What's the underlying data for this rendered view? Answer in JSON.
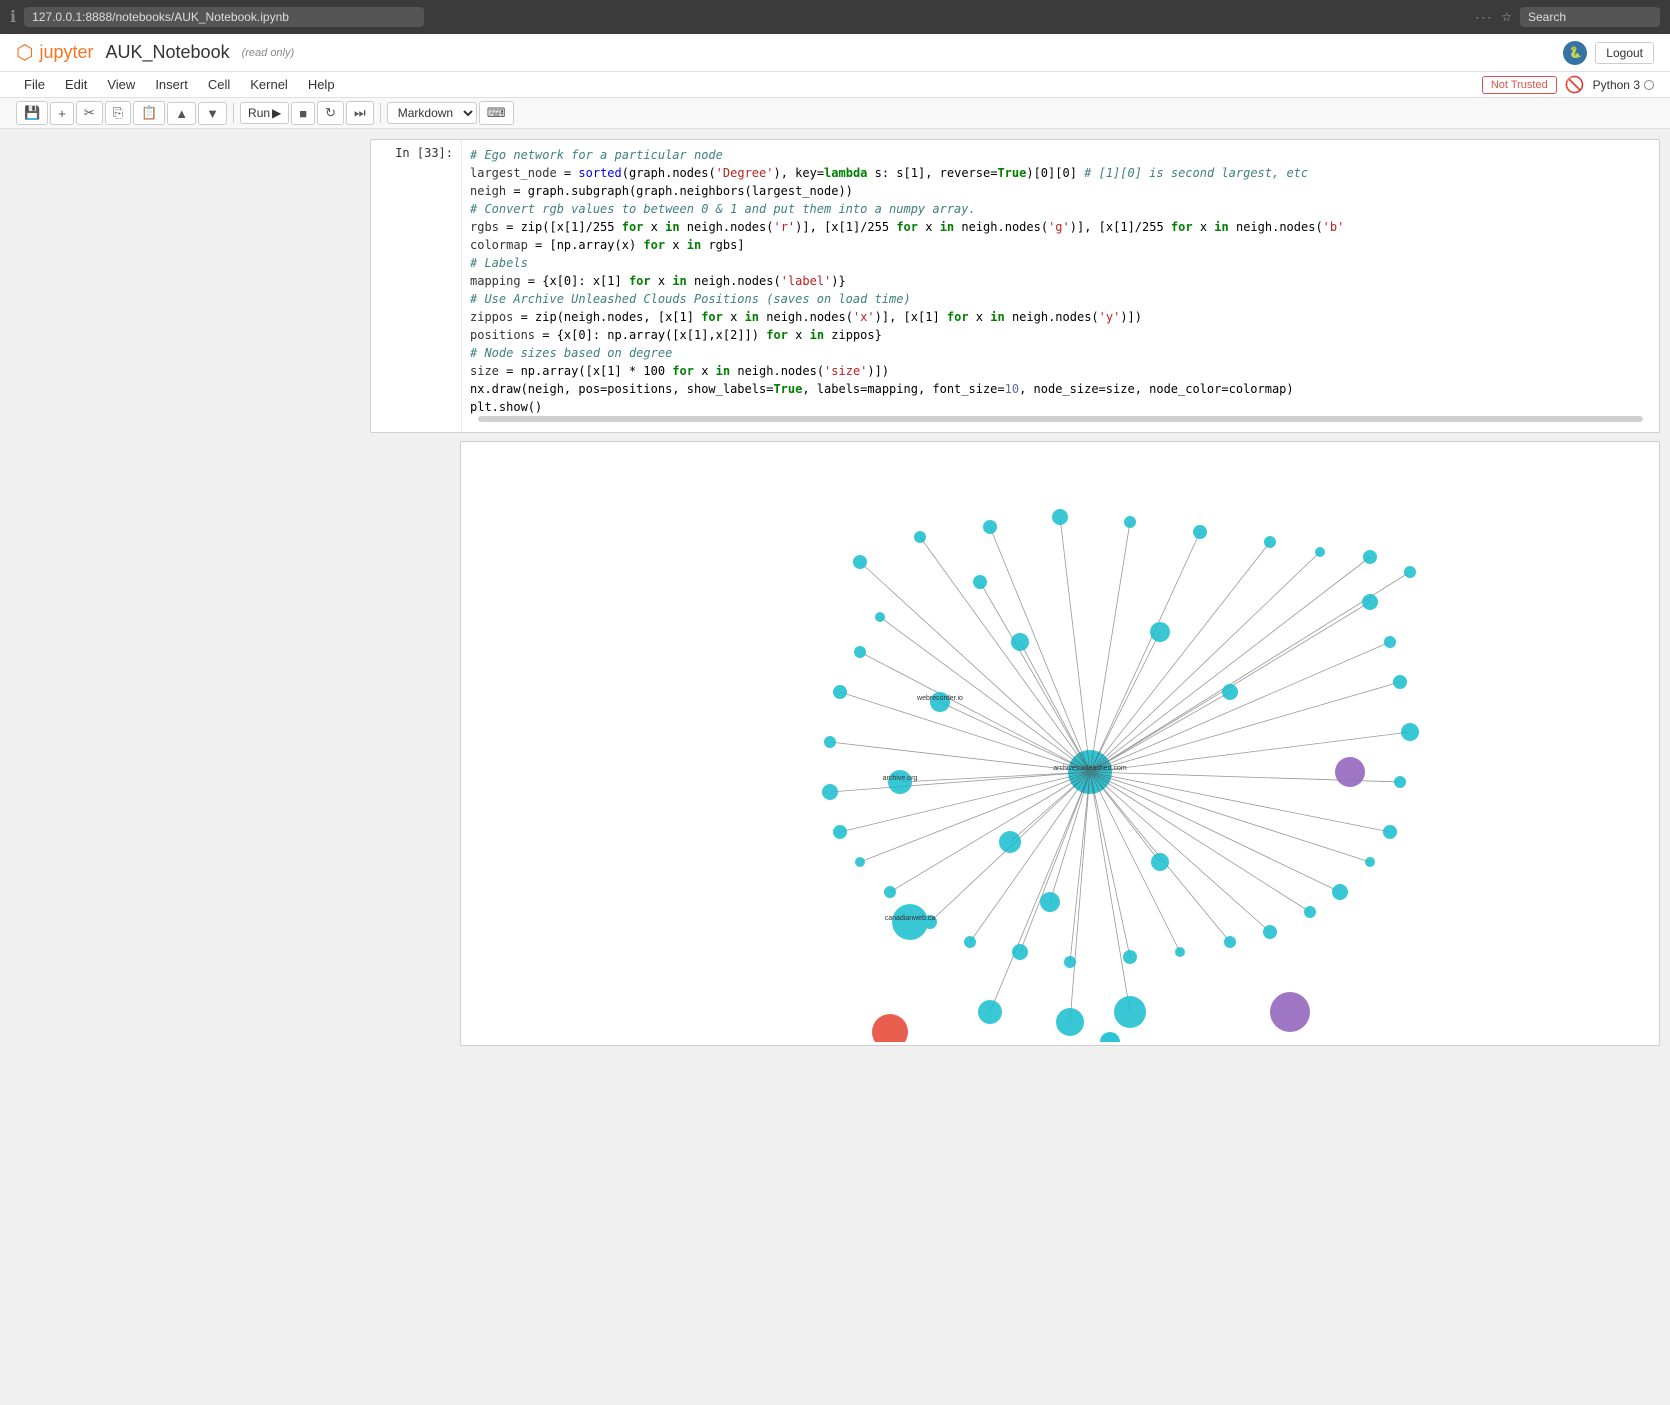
{
  "browser": {
    "url": "127.0.0.1:8888/notebooks/AUK_Notebook.ipynb",
    "search_placeholder": "Search"
  },
  "jupyter": {
    "logo_text": "jupyter",
    "notebook_title": "AUK_Notebook",
    "read_only_label": "(read only)",
    "logout_label": "Logout"
  },
  "menu": {
    "items": [
      "File",
      "Edit",
      "View",
      "Insert",
      "Cell",
      "Kernel",
      "Help"
    ],
    "not_trusted": "Not Trusted",
    "kernel_name": "Python 3"
  },
  "toolbar": {
    "cell_type": "Markdown",
    "run_label": "Run"
  },
  "cell": {
    "label": "In [33]:",
    "comment1": "# Ego network for a particular node",
    "line1a": "largest_node = sorted(graph.nodes(",
    "line1b": "'Degree'",
    "line1c": "), key=",
    "line1d": "lambda",
    "line1e": " s: s[1], reverse=",
    "line1f": "True",
    "line1g": ")[0][0]",
    "comment_line1": "# [1][0] is second largest, etc",
    "line2": "neigh = graph.subgraph(graph.neighbors(largest_node))",
    "comment2": "# Convert rgb values to between 0 & 1 and put them into a numpy array.",
    "line3a": "rgbs = zip([x[1]/255 ",
    "line3b": "for",
    "line3c": " x ",
    "line3d": "in",
    "line3e": " neigh.nodes(",
    "line3f": "'r'",
    "line3g": ")], [x[1]/255 ",
    "line3h": "for",
    "line3i": " x ",
    "line3j": "in",
    "line3k": " neigh.nodes(",
    "line3l": "'g'",
    "line3m": ")], [x[1]/255 ",
    "line3n": "for",
    "line3o": " x ",
    "line3p": "in",
    "line3q": " neigh.nodes(",
    "line3r": "'b'",
    "line4": "colormap = [np.array(x) for x in rgbs]",
    "comment3": "# Labels",
    "line5a": "mapping = {x[0]: x[1] ",
    "line5b": "for",
    "line5c": " x ",
    "line5d": "in",
    "line5e": " neigh.nodes(",
    "line5f": "'label'",
    "line5g": ")}",
    "comment4": "# Use Archive Unleashed Clouds Positions (saves on load time)",
    "line6a": "zippos = zip(neigh.nodes, [x[1] ",
    "line6b": "for",
    "line6c": " x ",
    "line6d": "in",
    "line6e": " neigh.nodes(",
    "line6f": "'x'",
    "line6g": ")], [x[1] ",
    "line6h": "for",
    "line6i": " x ",
    "line6j": "in",
    "line6k": " neigh.nodes(",
    "line6l": "'y'",
    "line6m": ")])",
    "line7a": "positions = {x[0]: np.array([x[1],x[2]]) ",
    "line7b": "for",
    "line7c": " x ",
    "line7d": "in",
    "line7e": " zippos}",
    "comment5": "# Node sizes based on degree",
    "line8a": "size = np.array([x[1] * 100 ",
    "line8b": "for",
    "line8c": " x ",
    "line8d": "in",
    "line8e": " neigh.nodes(",
    "line8f": "'size'",
    "line8g": ")])",
    "line9a": "nx.draw(neigh, pos=positions, show_labels=",
    "line9b": "True",
    "line9c": ", labels=mapping, font_size=",
    "line9d": "10",
    "line9e": ", node_size=size, node_color=colormap)",
    "line10": "plt.show()"
  }
}
